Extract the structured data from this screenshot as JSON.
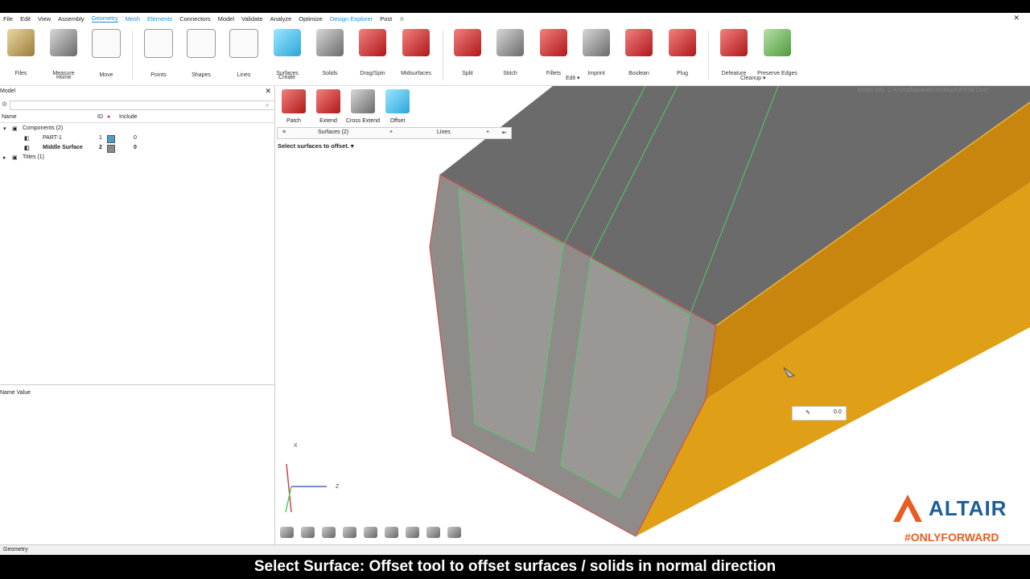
{
  "menu": {
    "items": [
      "File",
      "Edit",
      "View",
      "Assembly",
      "Geometry",
      "Mesh",
      "Elements",
      "Connectors",
      "Model",
      "Validate",
      "Analyze",
      "Optimize",
      "Design Explorer",
      "Post"
    ],
    "active": "Geometry"
  },
  "ribbon": {
    "tools": [
      "Files",
      "Measure",
      "Move",
      "Points",
      "Shapes",
      "Lines",
      "Surfaces",
      "Solids",
      "Drag/Spin",
      "Midsurfaces",
      "Split",
      "Stitch",
      "Fillets",
      "Imprint",
      "Boolean",
      "Plug",
      "Defeature",
      "Preserve Edges"
    ],
    "groups": {
      "home": "Home",
      "create": "Create",
      "edit": "Edit",
      "cleanup": "Cleanup"
    }
  },
  "subtools": [
    "Patch",
    "Extend",
    "Cross Extend",
    "Offset"
  ],
  "selection": {
    "surfaces": "Surfaces (2)",
    "lines": "Lines"
  },
  "prompt": "Select surfaces to offset.",
  "model_info": "Model Info: C:/Users/basavah/Desktop/OFFSET.hm*",
  "model_panel": {
    "title": "Model",
    "columns": {
      "name": "Name",
      "id": "ID",
      "include": "Include"
    },
    "tree": [
      {
        "label": "Components (2)"
      },
      {
        "label": "PART-1",
        "id": "1",
        "include": "0",
        "color": "#4d9cc9"
      },
      {
        "label": "Middle Surface",
        "id": "2",
        "include": "0",
        "color": "#8a8a8a"
      },
      {
        "label": "Titles (1)"
      }
    ]
  },
  "property_view": {
    "header": "Name Value"
  },
  "axes": {
    "x": "X",
    "z": "Z"
  },
  "value_box": "0.0",
  "status_bar": "Geometry",
  "brand": {
    "name": "ALTAIR",
    "tagline": "#ONLYFORWARD",
    "color": "#1b5f99",
    "accent": "#e85d21"
  },
  "caption": "Select Surface: Offset tool to offset surfaces / solids in normal direction"
}
